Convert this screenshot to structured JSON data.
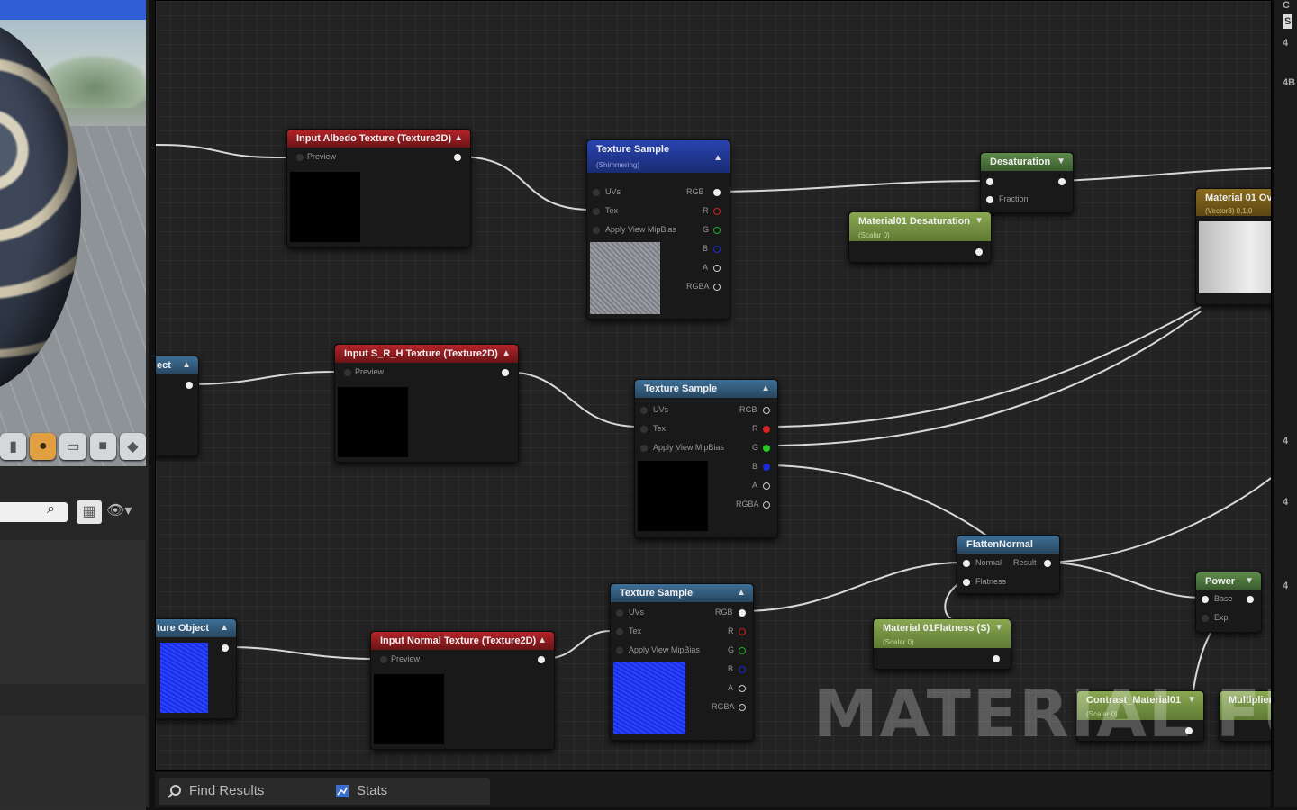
{
  "nodes": {
    "albedo": {
      "title": "Input Albedo Texture (Texture2D)",
      "pin": "Preview"
    },
    "sample1": {
      "title": "Texture Sample",
      "subtitle": "(Shimmering)",
      "pins_in": [
        "UVs",
        "Tex",
        "Apply View MipBias"
      ],
      "pins_out": [
        "RGB",
        "R",
        "G",
        "B",
        "A",
        "RGBA"
      ]
    },
    "desat": {
      "title": "Desaturation",
      "pin": "Fraction"
    },
    "mat_desat": {
      "title": "Material01 Desaturation",
      "subtitle": "(Scalar 0)"
    },
    "mat01": {
      "title": "Material 01 Ov",
      "subtitle": "(Vector3) 0,1,0"
    },
    "srh": {
      "title": "Input S_R_H Texture (Texture2D)",
      "pin": "Preview"
    },
    "obj_top": {
      "title": "ect"
    },
    "sample2": {
      "title": "Texture Sample",
      "pins_in": [
        "UVs",
        "Tex",
        "Apply View MipBias"
      ],
      "pins_out": [
        "RGB",
        "R",
        "G",
        "B",
        "A",
        "RGBA"
      ]
    },
    "flatten": {
      "title": "FlattenNormal",
      "pins_in": [
        "Normal",
        "Flatness"
      ],
      "pin_out": "Result"
    },
    "power": {
      "title": "Power",
      "pins_in": [
        "Base",
        "Exp"
      ]
    },
    "obj_bottom": {
      "title": "ture Object"
    },
    "normal": {
      "title": "Input Normal Texture (Texture2D)",
      "pin": "Preview"
    },
    "sample3": {
      "title": "Texture Sample",
      "pins_in": [
        "UVs",
        "Tex",
        "Apply View MipBias"
      ],
      "pins_out": [
        "RGB",
        "R",
        "G",
        "B",
        "A",
        "RGBA"
      ]
    },
    "mat_flat": {
      "title": "Material 01Flatness (S)",
      "subtitle": "(Scalar 0)"
    },
    "contrast": {
      "title": "Contrast_Material01",
      "subtitle": "(Scalar 0)"
    },
    "multiplier": {
      "title": "Multiplier"
    }
  },
  "watermark": "MATERIAL FUNCTION",
  "tabs": [
    {
      "label": "Find Results",
      "icon": "find-results-icon"
    },
    {
      "label": "Stats",
      "icon": "stats-icon"
    }
  ],
  "right_markers": [
    "C",
    "S",
    "4",
    "4B",
    "4",
    "4",
    "4"
  ],
  "colors": {
    "red_header": "#b4242a",
    "blue_header": "#2944b0",
    "green_header": "#5d8b4a",
    "accent_orange": "#e0a040"
  }
}
